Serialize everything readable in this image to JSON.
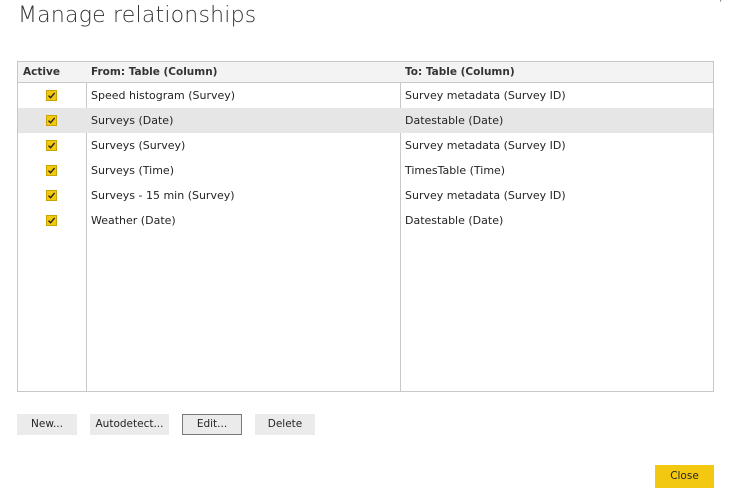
{
  "dialog": {
    "title": "Manage relationships"
  },
  "table": {
    "headers": {
      "active": "Active",
      "from": "From: Table (Column)",
      "to": "To: Table (Column)"
    },
    "rows": [
      {
        "active": true,
        "from": "Speed histogram (Survey)",
        "to": "Survey metadata (Survey ID)",
        "selected": false
      },
      {
        "active": true,
        "from": "Surveys (Date)",
        "to": "Datestable (Date)",
        "selected": true
      },
      {
        "active": true,
        "from": "Surveys (Survey)",
        "to": "Survey metadata (Survey ID)",
        "selected": false
      },
      {
        "active": true,
        "from": "Surveys (Time)",
        "to": "TimesTable (Time)",
        "selected": false
      },
      {
        "active": true,
        "from": "Surveys - 15 min (Survey)",
        "to": "Survey metadata (Survey ID)",
        "selected": false
      },
      {
        "active": true,
        "from": "Weather (Date)",
        "to": "Datestable (Date)",
        "selected": false
      }
    ]
  },
  "buttons": {
    "new": "New...",
    "autodetect": "Autodetect...",
    "edit": "Edit...",
    "delete": "Delete",
    "close": "Close"
  },
  "colors": {
    "accent": "#f2c811",
    "selected_row": "#e6e6e6",
    "header_bg": "#f3f3f3",
    "button_bg": "#ebebeb"
  }
}
